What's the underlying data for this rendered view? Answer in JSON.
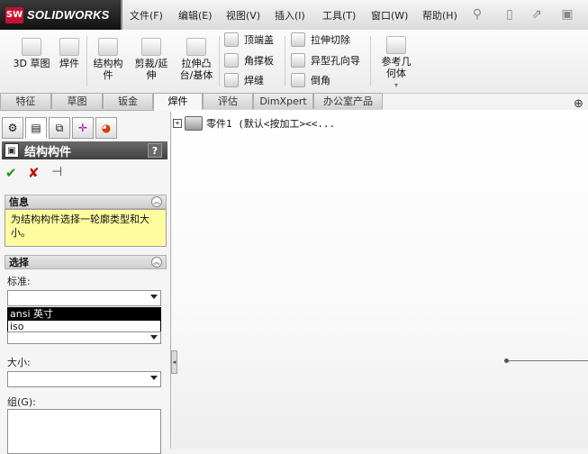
{
  "app": {
    "logo_text": "SOLIDWORKS",
    "logo_badge": "SW"
  },
  "menu": [
    "文件(F)",
    "编辑(E)",
    "视图(V)",
    "插入(I)",
    "工具(T)",
    "窗口(W)",
    "帮助(H)"
  ],
  "toolbar": {
    "big": [
      {
        "label": "3D 草图",
        "icon": "3d-sketch-icon"
      },
      {
        "label": "焊件",
        "icon": "weldment-icon"
      },
      {
        "label": "结构构\n件",
        "icon": "structural-member-icon"
      },
      {
        "label": "剪裁/延\n伸",
        "icon": "trim-extend-icon"
      },
      {
        "label": "拉伸凸\n台/基体",
        "icon": "extruded-boss-icon"
      },
      {
        "label": "参考几\n何体",
        "icon": "reference-geometry-icon"
      }
    ],
    "small_col1": [
      "顶端盖",
      "角撑板",
      "焊缝"
    ],
    "small_col2": [
      "拉伸切除",
      "异型孔向导",
      "倒角"
    ]
  },
  "tabs": [
    "特征",
    "草图",
    "钣金",
    "焊件",
    "评估",
    "DimXpert",
    "办公室产品"
  ],
  "active_tab": "焊件",
  "property_manager": {
    "title": "结构构件",
    "help": "?",
    "ok": "✔",
    "cancel": "✘",
    "pin": "⊣",
    "info_group": "信息",
    "info_text": "为结构构件选择一轮廓类型和大小。",
    "select_group": "选择",
    "standard_label": "标准:",
    "standard_value": "",
    "standard_options": [
      "ansi 英寸",
      "iso"
    ],
    "type_value": "",
    "size_label": "大小:",
    "size_value": "",
    "group_label": "组(G):"
  },
  "tree": {
    "root_label": "零件1 (默认<按加工><<..."
  },
  "colors": {
    "accent": "#c8102e",
    "info_bg": "#fffb9f",
    "header_bg": "#4a4a4a"
  }
}
